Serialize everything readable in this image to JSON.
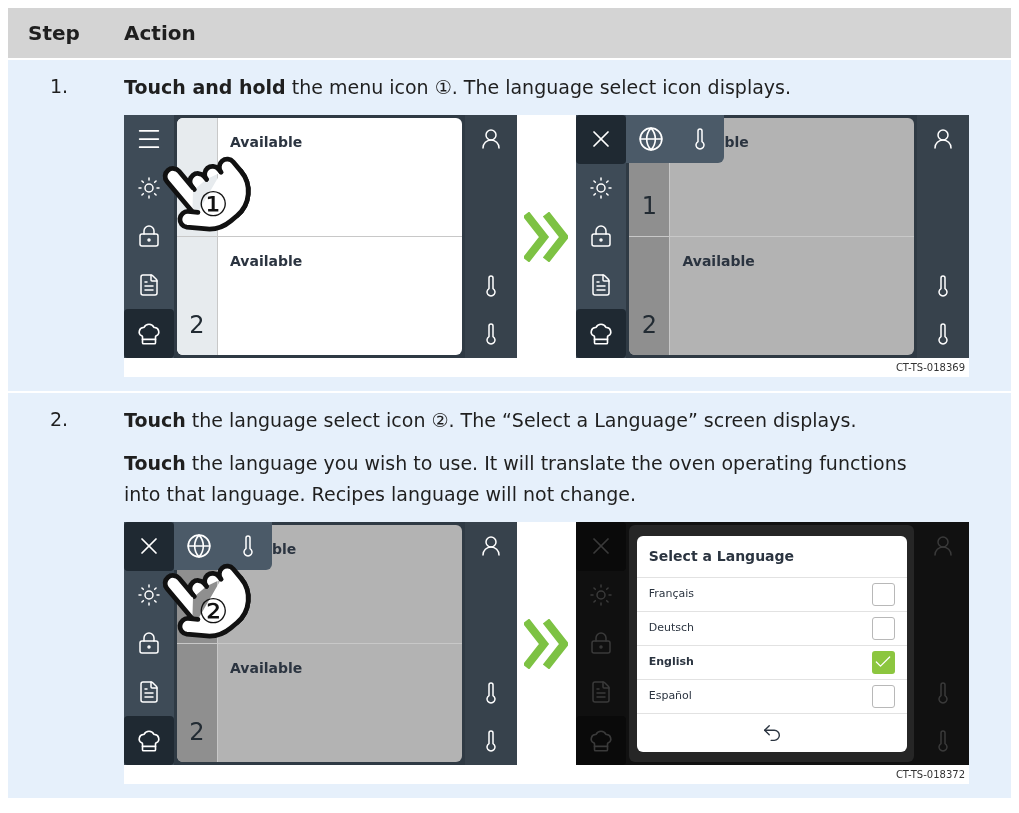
{
  "table": {
    "columns": [
      "Step",
      "Action"
    ],
    "rows": [
      {
        "step": "1.",
        "paragraphs": [
          "**Touch and hold** the menu icon ①. The language select icon displays."
        ],
        "figure": {
          "caption": "CT-TS-018369",
          "screens": [
            {
              "kind": "home",
              "callout": "①",
              "slots": [
                {
                  "title": "Available"
                },
                {
                  "number": "2",
                  "title": "Available"
                }
              ]
            },
            {
              "kind": "menu",
              "slots": [
                {
                  "number": "1",
                  "title": "ble"
                },
                {
                  "number": "2",
                  "title": "Available"
                }
              ]
            }
          ]
        }
      },
      {
        "step": "2.",
        "paragraphs": [
          "**Touch** the language select icon ②. The “Select a Language” screen displays.",
          "**Touch** the language you wish to use. It will translate the oven operating functions into that language. Recipes language will not change."
        ],
        "figure": {
          "caption": "CT-TS-018372",
          "screens": [
            {
              "kind": "menu",
              "callout": "②",
              "slots": [
                {
                  "title": "ble"
                },
                {
                  "number": "2",
                  "title": "Available"
                }
              ]
            },
            {
              "kind": "language",
              "dialog": {
                "title": "Select a Language",
                "options": [
                  {
                    "label": "Français",
                    "checked": false
                  },
                  {
                    "label": "Deutsch",
                    "checked": false
                  },
                  {
                    "label": "English",
                    "checked": true
                  },
                  {
                    "label": "Español",
                    "checked": false
                  }
                ]
              }
            }
          ]
        }
      }
    ]
  }
}
